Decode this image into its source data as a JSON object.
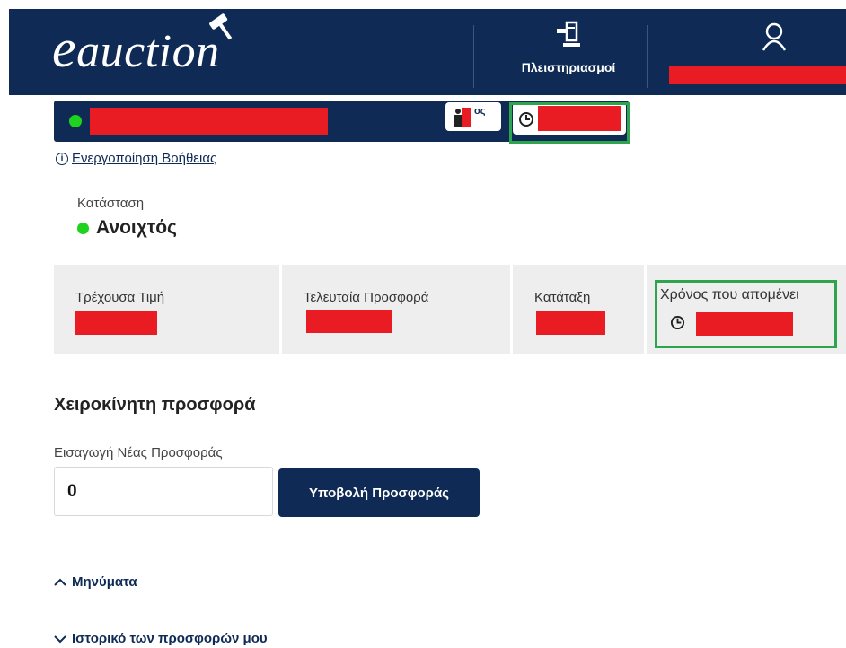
{
  "header": {
    "logo_e": "e",
    "logo_rest": "auction",
    "nav_auctions_label": "Πλειστηριασμοί",
    "icons": [
      "gavel-icon",
      "hammer-icon",
      "user-icon"
    ]
  },
  "auction_bar": {
    "status_color": "#1ed31e",
    "rank_suffix": "ος",
    "icons": [
      "ranking-person-icon",
      "clock-icon"
    ]
  },
  "help": {
    "icon_text": "i",
    "link_label": "Ενεργοποίηση Βοήθειας"
  },
  "status": {
    "label": "Κατάσταση",
    "value": "Ανοιχτός"
  },
  "info_cells": {
    "current_price_label": "Τρέχουσα Τιμή",
    "last_offer_label": "Τελευταία Προσφορά",
    "ranking_label": "Κατάταξη",
    "time_left_label": "Χρόνος που απομένει"
  },
  "manual_bid": {
    "title": "Χειροκίνητη προσφορά",
    "input_label": "Εισαγωγή Νέας Προσφοράς",
    "input_value": "0",
    "submit_label": "Υποβολή Προσφοράς"
  },
  "sections": {
    "messages_label": "Μηνύματα",
    "messages_state": "expanded",
    "history_label": "Ιστορικό των προσφορών μου",
    "history_state": "collapsed"
  },
  "colors": {
    "primary_navy": "#0f2b55",
    "redaction": "#e91c24",
    "highlight_green": "#2ea44f",
    "status_green": "#1ed31e",
    "cell_bg": "#eeeeee"
  }
}
